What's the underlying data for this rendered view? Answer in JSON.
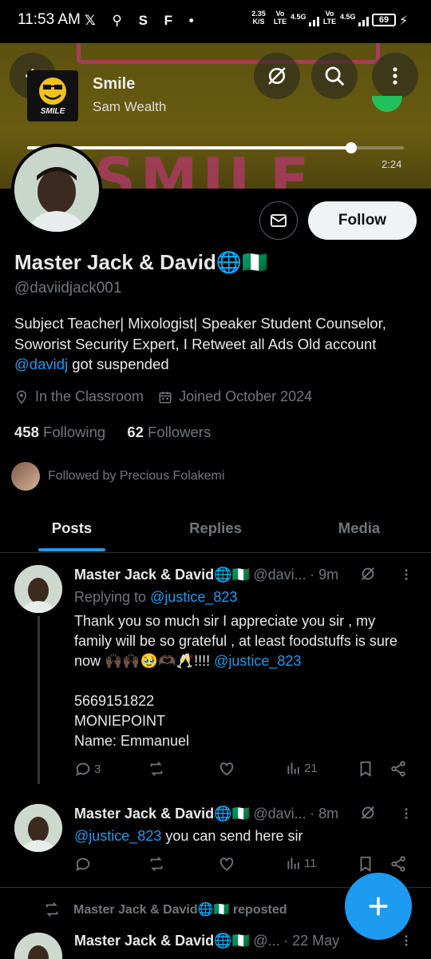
{
  "status_bar": {
    "time": "11:53 AM",
    "icons": "𝕏 ⚲ S F •",
    "speed": "2.35\nK/S",
    "net1": "Vo\nLTE",
    "net2": "4.5G",
    "net3": "Vo\nLTE",
    "net4": "4.5G",
    "battery": "69"
  },
  "music": {
    "title": "Smile",
    "artist": "Sam Wealth",
    "cover_label": "SMILE",
    "time": "2:24",
    "progress": 0.86
  },
  "profile": {
    "follow_label": "Follow",
    "display_name": "Master Jack & David🌐🇳🇬",
    "handle": "@daviidjack001",
    "bio_text": "Subject Teacher| Mixologist| Speaker Student Counselor, Soworist Security Expert, I Retweet all Ads Old account ",
    "bio_link": "@davidj",
    "bio_tail": " got suspended",
    "location": "In the Classroom",
    "joined": "Joined October 2024",
    "following_count": "458",
    "following_label": "Following",
    "followers_count": "62",
    "followers_label": "Followers",
    "followed_by": "Followed by Precious Folakemi"
  },
  "tabs": [
    {
      "label": "Posts"
    },
    {
      "label": "Replies"
    },
    {
      "label": "Media"
    }
  ],
  "tweets": [
    {
      "name": "Master Jack & David🌐🇳🇬",
      "handle": "@davi...",
      "time": "· 9m",
      "replying_prefix": "Replying to ",
      "replying_to": "@justice_823",
      "text_main": "Thank you so much sir I appreciate you sir , my family will be so grateful , at least foodstuffs is sure now 🙌🏿🙌🏿🥹🫶🏿🥂!!!! ",
      "text_link": "@justice_823",
      "line1": "5669151822",
      "line2": "MONIEPOINT",
      "line3": "Name: Emmanuel",
      "replies": "3",
      "views": "21"
    },
    {
      "name": "Master Jack & David🌐🇳🇬",
      "handle": "@davi...",
      "time": "· 8m",
      "text_link": "@justice_823",
      "text_main": " you can send here sir",
      "views": "11"
    },
    {
      "repost_label": "Master Jack & David🌐🇳🇬 reposted",
      "name": "Master Jack & David🌐🇳🇬",
      "handle": "@...",
      "time": "· 22 May"
    }
  ],
  "colors": {
    "accent": "#1d9bf0",
    "muted": "#71767b",
    "text": "#e7e9ea",
    "background": "#000000"
  }
}
